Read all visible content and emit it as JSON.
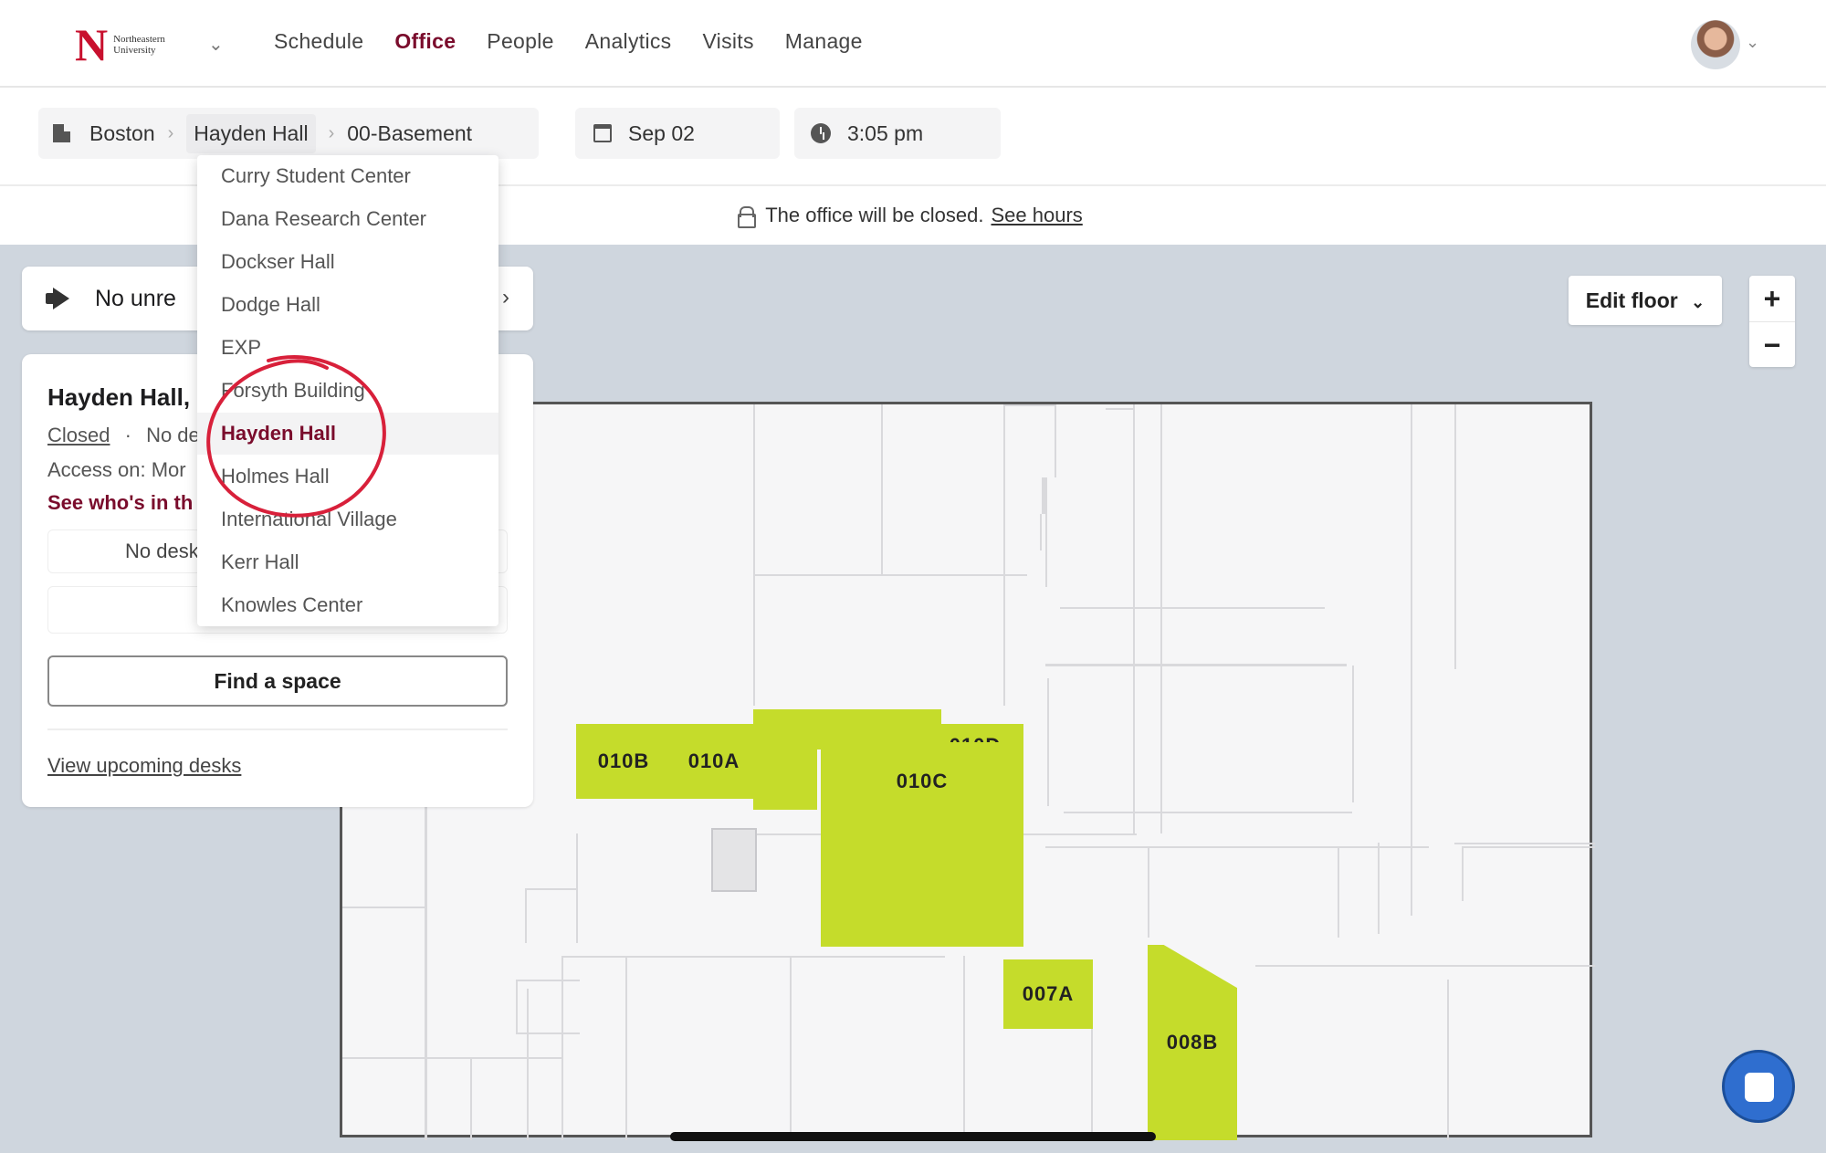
{
  "brand": {
    "logo_letter": "N",
    "logo_text": "Northeastern University"
  },
  "nav": [
    "Schedule",
    "Office",
    "People",
    "Analytics",
    "Visits",
    "Manage"
  ],
  "breadcrumb": {
    "city": "Boston",
    "building": "Hayden Hall",
    "floor": "00-Basement"
  },
  "date": "Sep 02",
  "time": "3:05 pm",
  "banner": {
    "text": "The office will be closed.",
    "link": "See hours"
  },
  "notice": {
    "text": "No unre"
  },
  "info": {
    "title": "Hayden Hall,",
    "status": "Closed",
    "status_sep": "·",
    "status_rest": "No de",
    "access": "Access on: Mor",
    "whos_in": "See who's in th",
    "no_desk": "No desk r",
    "find_space": "Find a space",
    "view_upcoming": "View upcoming desks"
  },
  "dropdown": {
    "items": [
      "Curry Student Center",
      "Dana Research Center",
      "Dockser Hall",
      "Dodge Hall",
      "EXP",
      "Forsyth Building",
      "Hayden Hall",
      "Holmes Hall",
      "International Village",
      "Kerr Hall",
      "Knowles Center"
    ],
    "selected": "Hayden Hall"
  },
  "controls": {
    "edit_floor": "Edit floor",
    "zoom_in": "+",
    "zoom_out": "−"
  },
  "rooms": [
    "010B",
    "010A",
    "010D",
    "010C",
    "007A",
    "008B"
  ],
  "colors": {
    "accent": "#7a0c2c",
    "room": "#c5dc2b",
    "annotation": "#d8203a"
  }
}
